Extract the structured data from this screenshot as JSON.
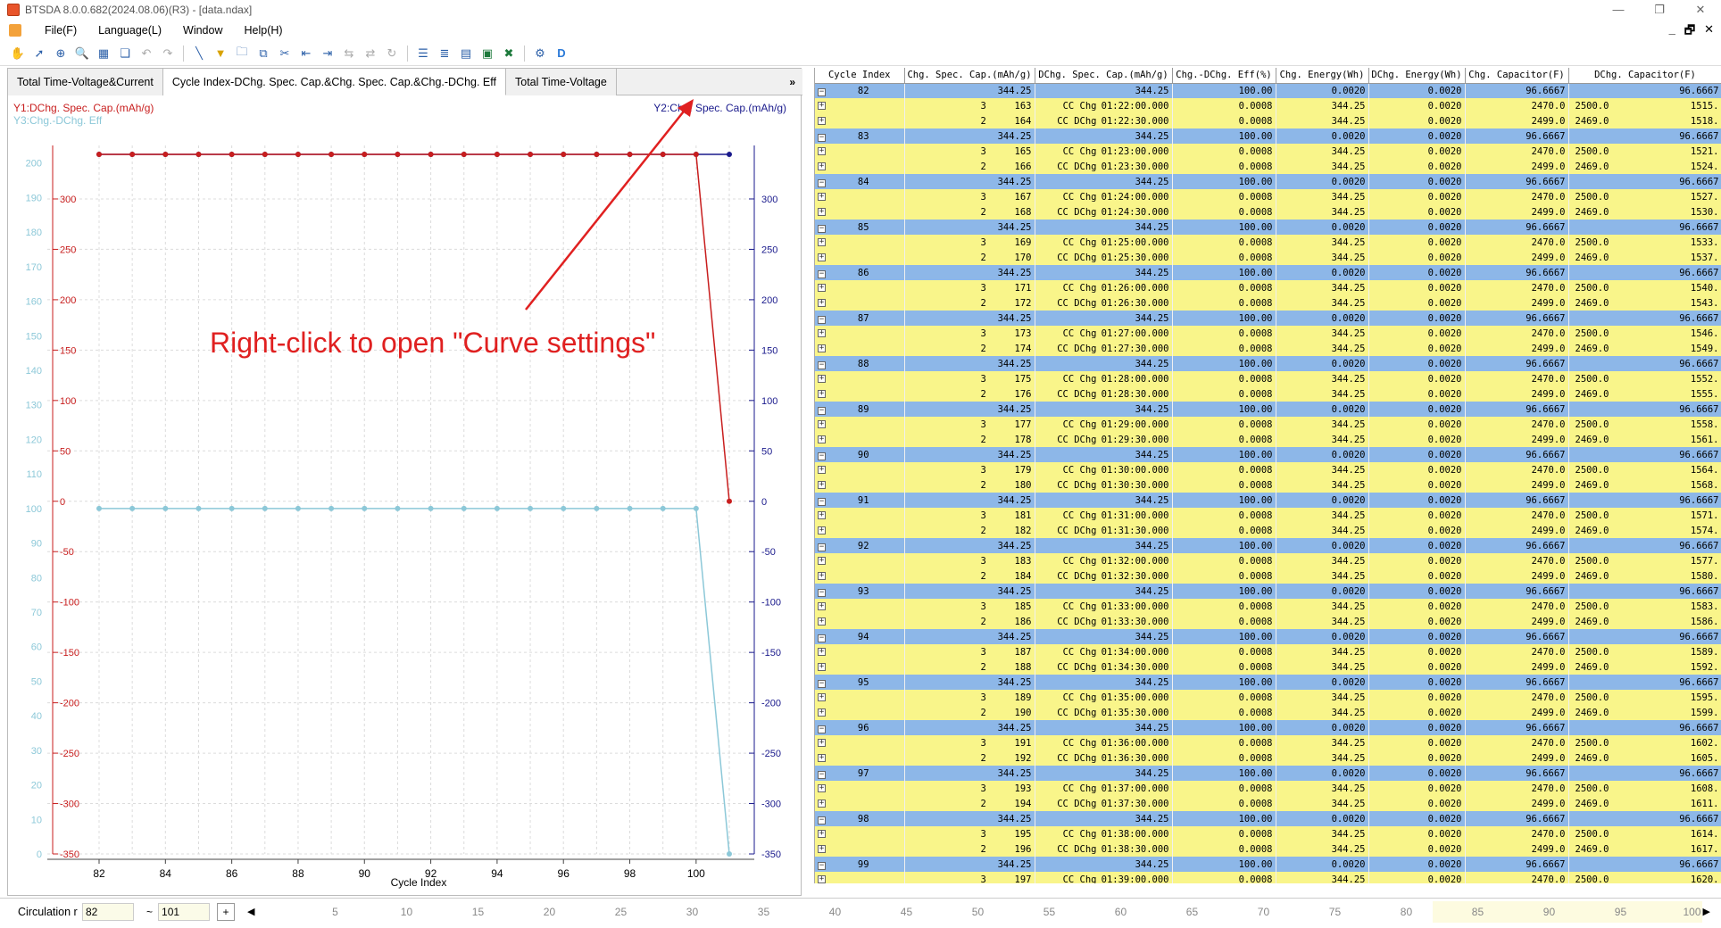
{
  "window": {
    "title": "BTSDA 8.0.0.682(2024.08.06)(R3) - [data.ndax]",
    "controls": [
      "—",
      "❐",
      "✕"
    ],
    "mdi_controls": [
      "_",
      "🗗",
      "✕"
    ]
  },
  "menu": [
    "File(F)",
    "Language(L)",
    "Window",
    "Help(H)"
  ],
  "tabs": [
    "Total Time-Voltage&Current",
    "Cycle Index-DChg. Spec. Cap.&Chg. Spec. Cap.&Chg.-DChg. Eff",
    "Total Time-Voltage"
  ],
  "tabs_more": "»",
  "annotation": "Right-click to open \"Curve settings\"",
  "chart_data": {
    "type": "line",
    "xlabel": "Cycle Index",
    "y1label": "Y1:DChg. Spec. Cap.(mAh/g)",
    "y2label": "Y2:Chg. Spec. Cap.(mAh/g)",
    "y3label": "Y3:Chg.-DChg. Eff",
    "x_ticks": [
      82,
      84,
      86,
      88,
      90,
      92,
      94,
      96,
      98,
      100
    ],
    "xlim": [
      82,
      101
    ],
    "y1_ticks": [
      -350,
      -300,
      -250,
      -200,
      -150,
      -100,
      -50,
      0,
      50,
      100,
      150,
      200,
      250,
      300
    ],
    "y1lim": [
      -350,
      344.25
    ],
    "y2_ticks": [
      -350,
      -300,
      -250,
      -200,
      -150,
      -100,
      -50,
      0,
      50,
      100,
      150,
      200,
      250,
      300
    ],
    "y2lim": [
      -350,
      344.25
    ],
    "y3_ticks": [
      0,
      10,
      20,
      30,
      40,
      50,
      60,
      70,
      80,
      90,
      100,
      110,
      120,
      130,
      140,
      150,
      160,
      170,
      180,
      190,
      200
    ],
    "y3lim": [
      0,
      202.5
    ],
    "series": [
      {
        "name": "Y2:Chg. Spec. Cap.(mAh/g)",
        "axis": "y2",
        "color": "#1a1a8c",
        "x": [
          82,
          83,
          84,
          85,
          86,
          87,
          88,
          89,
          90,
          91,
          92,
          93,
          94,
          95,
          96,
          97,
          98,
          99,
          100,
          101
        ],
        "values": [
          344.25,
          344.25,
          344.25,
          344.25,
          344.25,
          344.25,
          344.25,
          344.25,
          344.25,
          344.25,
          344.25,
          344.25,
          344.25,
          344.25,
          344.25,
          344.25,
          344.25,
          344.25,
          344.25,
          344.25
        ]
      },
      {
        "name": "Y1:DChg. Spec. Cap.(mAh/g)",
        "axis": "y1",
        "color": "#c81e1e",
        "x": [
          82,
          83,
          84,
          85,
          86,
          87,
          88,
          89,
          90,
          91,
          92,
          93,
          94,
          95,
          96,
          97,
          98,
          99,
          100,
          101
        ],
        "values": [
          344.25,
          344.25,
          344.25,
          344.25,
          344.25,
          344.25,
          344.25,
          344.25,
          344.25,
          344.25,
          344.25,
          344.25,
          344.25,
          344.25,
          344.25,
          344.25,
          344.25,
          344.25,
          344.25,
          0
        ]
      },
      {
        "name": "Y3:Chg.-DChg. Eff",
        "axis": "y3",
        "color": "#8cc8d8",
        "x": [
          82,
          83,
          84,
          85,
          86,
          87,
          88,
          89,
          90,
          91,
          92,
          93,
          94,
          95,
          96,
          97,
          98,
          99,
          100,
          101
        ],
        "values": [
          100,
          100,
          100,
          100,
          100,
          100,
          100,
          100,
          100,
          100,
          100,
          100,
          100,
          100,
          100,
          100,
          100,
          100,
          100,
          0
        ]
      }
    ]
  },
  "table": {
    "columns": [
      "Cycle Index",
      "Chg. Spec. Cap.(mAh/g)",
      "DChg. Spec. Cap.(mAh/g)",
      "Chg.-DChg. Eff(%)",
      "Chg. Energy(Wh)",
      "DChg. Energy(Wh)",
      "Chg. Capacitor(F)",
      "DChg. Capacitor(F)"
    ],
    "cycles": [
      {
        "cycle": "82",
        "summary": [
          "344.25",
          "344.25",
          "100.00",
          "0.0020",
          "0.0020",
          "96.6667",
          "96.6667"
        ],
        "steps": [
          [
            "3",
            "163",
            "CC Chg",
            "01:22:00.000",
            "0.0008",
            "344.25",
            "0.0020",
            "2470.0",
            "2500.0",
            "1515."
          ],
          [
            "2",
            "164",
            "CC DChg",
            "01:22:30.000",
            "0.0008",
            "344.25",
            "0.0020",
            "2499.0",
            "2469.0",
            "1518."
          ]
        ]
      },
      {
        "cycle": "83",
        "summary": [
          "344.25",
          "344.25",
          "100.00",
          "0.0020",
          "0.0020",
          "96.6667",
          "96.6667"
        ],
        "steps": [
          [
            "3",
            "165",
            "CC Chg",
            "01:23:00.000",
            "0.0008",
            "344.25",
            "0.0020",
            "2470.0",
            "2500.0",
            "1521."
          ],
          [
            "2",
            "166",
            "CC DChg",
            "01:23:30.000",
            "0.0008",
            "344.25",
            "0.0020",
            "2499.0",
            "2469.0",
            "1524."
          ]
        ]
      },
      {
        "cycle": "84",
        "summary": [
          "344.25",
          "344.25",
          "100.00",
          "0.0020",
          "0.0020",
          "96.6667",
          "96.6667"
        ],
        "steps": [
          [
            "3",
            "167",
            "CC Chg",
            "01:24:00.000",
            "0.0008",
            "344.25",
            "0.0020",
            "2470.0",
            "2500.0",
            "1527."
          ],
          [
            "2",
            "168",
            "CC DChg",
            "01:24:30.000",
            "0.0008",
            "344.25",
            "0.0020",
            "2499.0",
            "2469.0",
            "1530."
          ]
        ]
      },
      {
        "cycle": "85",
        "summary": [
          "344.25",
          "344.25",
          "100.00",
          "0.0020",
          "0.0020",
          "96.6667",
          "96.6667"
        ],
        "steps": [
          [
            "3",
            "169",
            "CC Chg",
            "01:25:00.000",
            "0.0008",
            "344.25",
            "0.0020",
            "2470.0",
            "2500.0",
            "1533."
          ],
          [
            "2",
            "170",
            "CC DChg",
            "01:25:30.000",
            "0.0008",
            "344.25",
            "0.0020",
            "2499.0",
            "2469.0",
            "1537."
          ]
        ]
      },
      {
        "cycle": "86",
        "summary": [
          "344.25",
          "344.25",
          "100.00",
          "0.0020",
          "0.0020",
          "96.6667",
          "96.6667"
        ],
        "steps": [
          [
            "3",
            "171",
            "CC Chg",
            "01:26:00.000",
            "0.0008",
            "344.25",
            "0.0020",
            "2470.0",
            "2500.0",
            "1540."
          ],
          [
            "2",
            "172",
            "CC DChg",
            "01:26:30.000",
            "0.0008",
            "344.25",
            "0.0020",
            "2499.0",
            "2469.0",
            "1543."
          ]
        ]
      },
      {
        "cycle": "87",
        "summary": [
          "344.25",
          "344.25",
          "100.00",
          "0.0020",
          "0.0020",
          "96.6667",
          "96.6667"
        ],
        "steps": [
          [
            "3",
            "173",
            "CC Chg",
            "01:27:00.000",
            "0.0008",
            "344.25",
            "0.0020",
            "2470.0",
            "2500.0",
            "1546."
          ],
          [
            "2",
            "174",
            "CC DChg",
            "01:27:30.000",
            "0.0008",
            "344.25",
            "0.0020",
            "2499.0",
            "2469.0",
            "1549."
          ]
        ]
      },
      {
        "cycle": "88",
        "summary": [
          "344.25",
          "344.25",
          "100.00",
          "0.0020",
          "0.0020",
          "96.6667",
          "96.6667"
        ],
        "steps": [
          [
            "3",
            "175",
            "CC Chg",
            "01:28:00.000",
            "0.0008",
            "344.25",
            "0.0020",
            "2470.0",
            "2500.0",
            "1552."
          ],
          [
            "2",
            "176",
            "CC DChg",
            "01:28:30.000",
            "0.0008",
            "344.25",
            "0.0020",
            "2499.0",
            "2469.0",
            "1555."
          ]
        ]
      },
      {
        "cycle": "89",
        "summary": [
          "344.25",
          "344.25",
          "100.00",
          "0.0020",
          "0.0020",
          "96.6667",
          "96.6667"
        ],
        "steps": [
          [
            "3",
            "177",
            "CC Chg",
            "01:29:00.000",
            "0.0008",
            "344.25",
            "0.0020",
            "2470.0",
            "2500.0",
            "1558."
          ],
          [
            "2",
            "178",
            "CC DChg",
            "01:29:30.000",
            "0.0008",
            "344.25",
            "0.0020",
            "2499.0",
            "2469.0",
            "1561."
          ]
        ]
      },
      {
        "cycle": "90",
        "summary": [
          "344.25",
          "344.25",
          "100.00",
          "0.0020",
          "0.0020",
          "96.6667",
          "96.6667"
        ],
        "steps": [
          [
            "3",
            "179",
            "CC Chg",
            "01:30:00.000",
            "0.0008",
            "344.25",
            "0.0020",
            "2470.0",
            "2500.0",
            "1564."
          ],
          [
            "2",
            "180",
            "CC DChg",
            "01:30:30.000",
            "0.0008",
            "344.25",
            "0.0020",
            "2499.0",
            "2469.0",
            "1568."
          ]
        ]
      },
      {
        "cycle": "91",
        "summary": [
          "344.25",
          "344.25",
          "100.00",
          "0.0020",
          "0.0020",
          "96.6667",
          "96.6667"
        ],
        "steps": [
          [
            "3",
            "181",
            "CC Chg",
            "01:31:00.000",
            "0.0008",
            "344.25",
            "0.0020",
            "2470.0",
            "2500.0",
            "1571."
          ],
          [
            "2",
            "182",
            "CC DChg",
            "01:31:30.000",
            "0.0008",
            "344.25",
            "0.0020",
            "2499.0",
            "2469.0",
            "1574."
          ]
        ]
      },
      {
        "cycle": "92",
        "summary": [
          "344.25",
          "344.25",
          "100.00",
          "0.0020",
          "0.0020",
          "96.6667",
          "96.6667"
        ],
        "steps": [
          [
            "3",
            "183",
            "CC Chg",
            "01:32:00.000",
            "0.0008",
            "344.25",
            "0.0020",
            "2470.0",
            "2500.0",
            "1577."
          ],
          [
            "2",
            "184",
            "CC DChg",
            "01:32:30.000",
            "0.0008",
            "344.25",
            "0.0020",
            "2499.0",
            "2469.0",
            "1580."
          ]
        ]
      },
      {
        "cycle": "93",
        "summary": [
          "344.25",
          "344.25",
          "100.00",
          "0.0020",
          "0.0020",
          "96.6667",
          "96.6667"
        ],
        "steps": [
          [
            "3",
            "185",
            "CC Chg",
            "01:33:00.000",
            "0.0008",
            "344.25",
            "0.0020",
            "2470.0",
            "2500.0",
            "1583."
          ],
          [
            "2",
            "186",
            "CC DChg",
            "01:33:30.000",
            "0.0008",
            "344.25",
            "0.0020",
            "2499.0",
            "2469.0",
            "1586."
          ]
        ]
      },
      {
        "cycle": "94",
        "summary": [
          "344.25",
          "344.25",
          "100.00",
          "0.0020",
          "0.0020",
          "96.6667",
          "96.6667"
        ],
        "steps": [
          [
            "3",
            "187",
            "CC Chg",
            "01:34:00.000",
            "0.0008",
            "344.25",
            "0.0020",
            "2470.0",
            "2500.0",
            "1589."
          ],
          [
            "2",
            "188",
            "CC DChg",
            "01:34:30.000",
            "0.0008",
            "344.25",
            "0.0020",
            "2499.0",
            "2469.0",
            "1592."
          ]
        ]
      },
      {
        "cycle": "95",
        "summary": [
          "344.25",
          "344.25",
          "100.00",
          "0.0020",
          "0.0020",
          "96.6667",
          "96.6667"
        ],
        "steps": [
          [
            "3",
            "189",
            "CC Chg",
            "01:35:00.000",
            "0.0008",
            "344.25",
            "0.0020",
            "2470.0",
            "2500.0",
            "1595."
          ],
          [
            "2",
            "190",
            "CC DChg",
            "01:35:30.000",
            "0.0008",
            "344.25",
            "0.0020",
            "2499.0",
            "2469.0",
            "1599."
          ]
        ]
      },
      {
        "cycle": "96",
        "summary": [
          "344.25",
          "344.25",
          "100.00",
          "0.0020",
          "0.0020",
          "96.6667",
          "96.6667"
        ],
        "steps": [
          [
            "3",
            "191",
            "CC Chg",
            "01:36:00.000",
            "0.0008",
            "344.25",
            "0.0020",
            "2470.0",
            "2500.0",
            "1602."
          ],
          [
            "2",
            "192",
            "CC DChg",
            "01:36:30.000",
            "0.0008",
            "344.25",
            "0.0020",
            "2499.0",
            "2469.0",
            "1605."
          ]
        ]
      },
      {
        "cycle": "97",
        "summary": [
          "344.25",
          "344.25",
          "100.00",
          "0.0020",
          "0.0020",
          "96.6667",
          "96.6667"
        ],
        "steps": [
          [
            "3",
            "193",
            "CC Chg",
            "01:37:00.000",
            "0.0008",
            "344.25",
            "0.0020",
            "2470.0",
            "2500.0",
            "1608."
          ],
          [
            "2",
            "194",
            "CC DChg",
            "01:37:30.000",
            "0.0008",
            "344.25",
            "0.0020",
            "2499.0",
            "2469.0",
            "1611."
          ]
        ]
      },
      {
        "cycle": "98",
        "summary": [
          "344.25",
          "344.25",
          "100.00",
          "0.0020",
          "0.0020",
          "96.6667",
          "96.6667"
        ],
        "steps": [
          [
            "3",
            "195",
            "CC Chg",
            "01:38:00.000",
            "0.0008",
            "344.25",
            "0.0020",
            "2470.0",
            "2500.0",
            "1614."
          ],
          [
            "2",
            "196",
            "CC DChg",
            "01:38:30.000",
            "0.0008",
            "344.25",
            "0.0020",
            "2499.0",
            "2469.0",
            "1617."
          ]
        ]
      },
      {
        "cycle": "99",
        "summary": [
          "344.25",
          "344.25",
          "100.00",
          "0.0020",
          "0.0020",
          "96.6667",
          "96.6667"
        ],
        "steps": [
          [
            "3",
            "197",
            "CC Chg",
            "01:39:00.000",
            "0.0008",
            "344.25",
            "0.0020",
            "2470.0",
            "2500.0",
            "1620."
          ]
        ]
      }
    ]
  },
  "bottom": {
    "label": "Circulation r",
    "from": "82",
    "tilde": "~",
    "to": "101",
    "plus": "+",
    "scale_ticks": [
      5,
      10,
      15,
      20,
      25,
      30,
      35,
      40,
      45,
      50,
      55,
      60,
      65,
      70,
      75,
      80,
      85,
      90,
      95,
      100
    ]
  },
  "colors": {
    "cycle_row": "#8db7e8",
    "step_row": "#f9f58a",
    "annotation": "#e02020",
    "y1": "#c81e1e",
    "y2": "#1a1a8c",
    "y3": "#8cc8d8"
  }
}
